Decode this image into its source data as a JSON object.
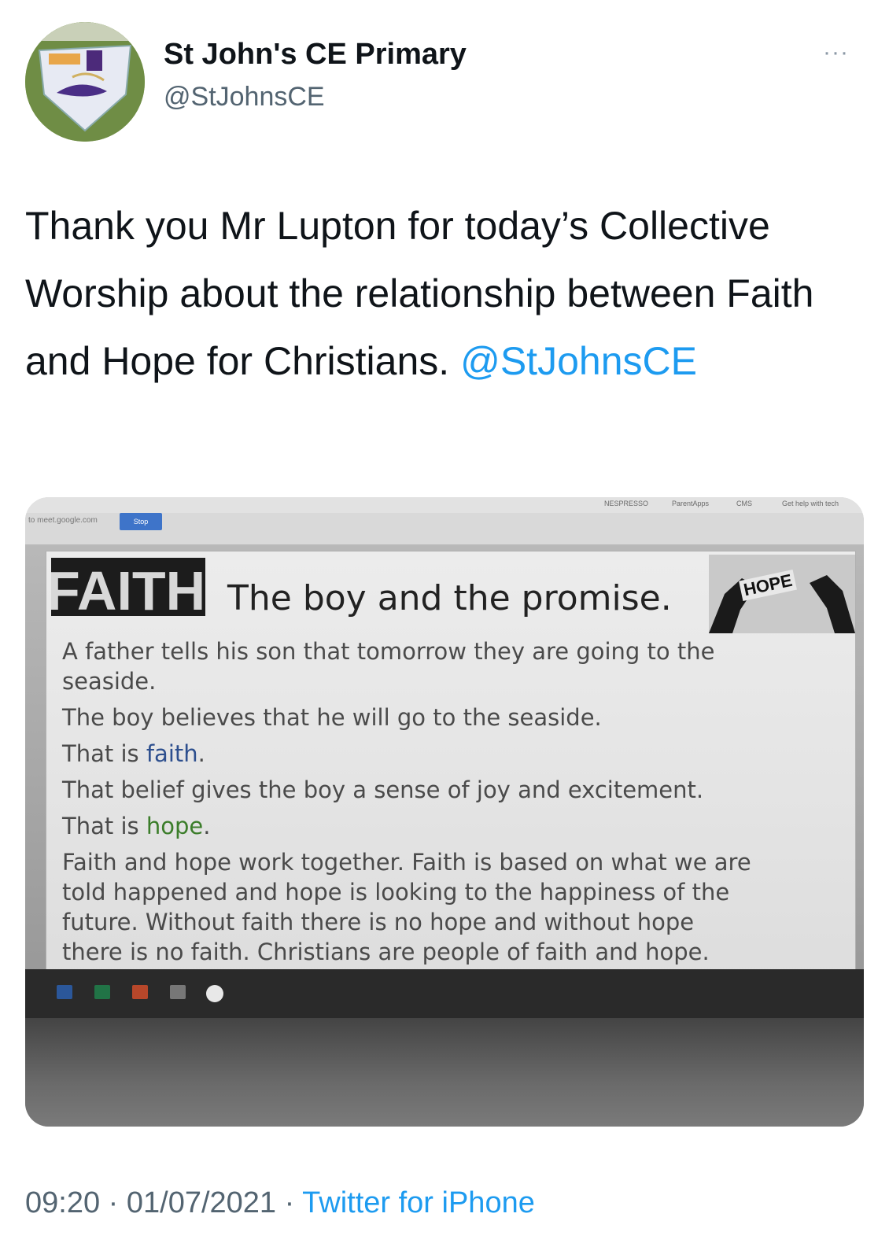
{
  "account": {
    "name": "St John's CE Primary",
    "handle": "@StJohnsCE",
    "avatar_icon": "school-logo-avatar"
  },
  "more_icon": "···",
  "tweet": {
    "text": "Thank you Mr Lupton for today’s Collective Worship about the relationship between Faith and Hope for Christians.",
    "mention": "@StJohnsCE"
  },
  "media": {
    "browser": {
      "url": "to meet.google.com",
      "stop_label": "Stop",
      "bookmarks": [
        "NESPRESSO",
        "ParentApps",
        "CMS",
        "Get help with tech"
      ]
    },
    "slide": {
      "logo_text": "FAITH",
      "title": "The boy and the promise.",
      "hope_image_text": "HOPE",
      "lines": [
        "A father tells his son that tomorrow they are going to the",
        "seaside.",
        "The boy believes that he will go to the seaside.",
        "That is",
        "faith",
        ".",
        "That belief gives the boy a sense of joy and excitement.",
        "That is",
        "hope",
        ".",
        "Faith and hope work together. Faith is based on what we are",
        "told happened and hope is looking to the happiness of the",
        "future. Without faith there is no hope and without hope",
        "there is no faith. Christians are people of faith and hope."
      ]
    },
    "taskbar_icons": [
      "word-icon",
      "excel-icon",
      "powerpoint-icon",
      "app-icon",
      "chrome-icon"
    ]
  },
  "meta": {
    "time": "09:20",
    "sep1": " · ",
    "date": "01/07/2021",
    "sep2": " · ",
    "source": "Twitter for iPhone"
  }
}
